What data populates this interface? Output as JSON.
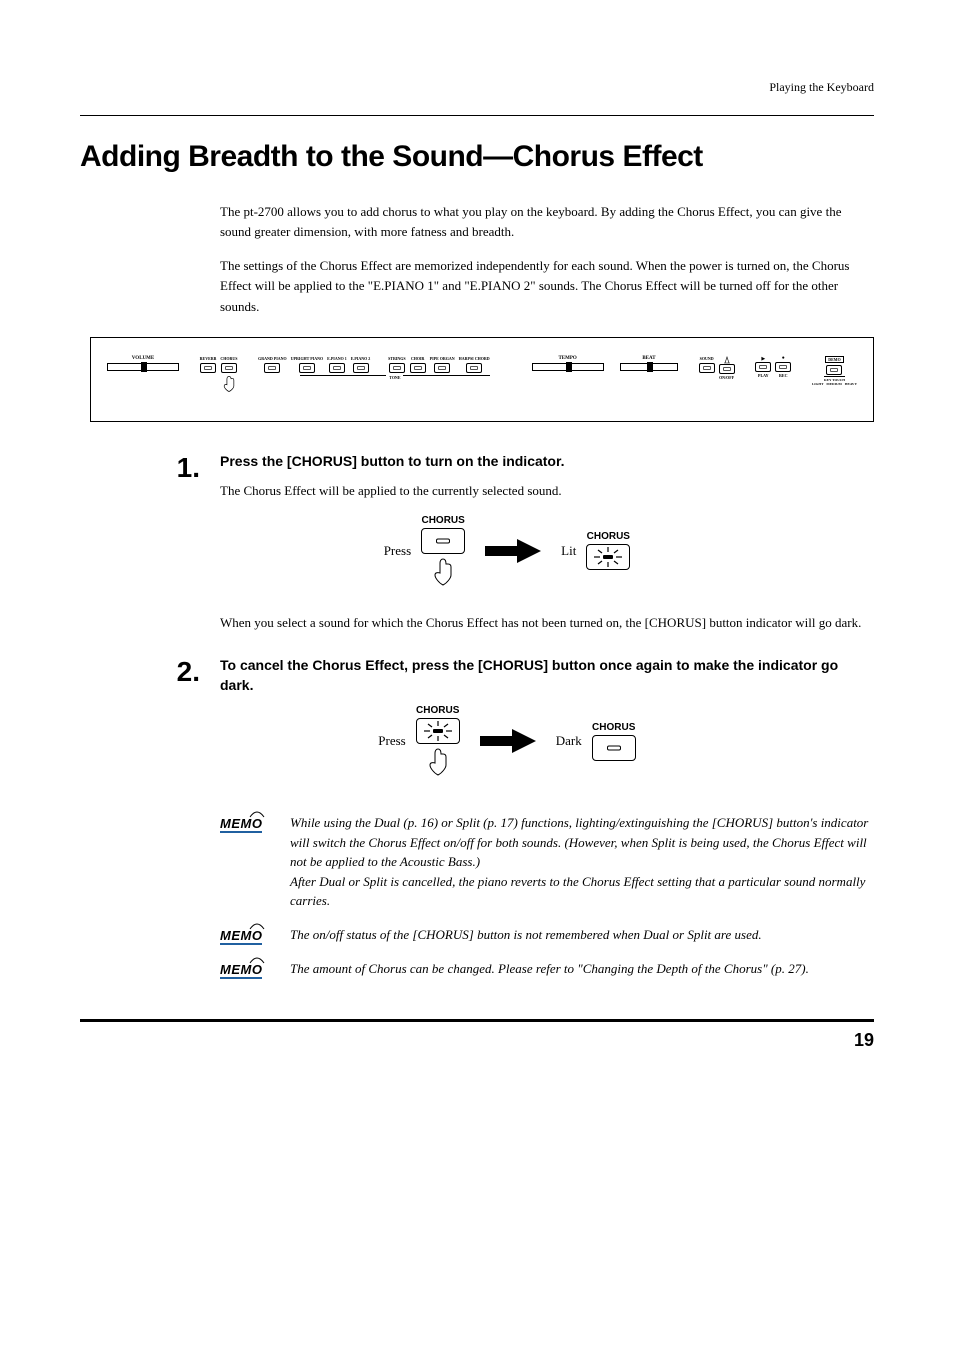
{
  "header": {
    "section": "Playing the Keyboard"
  },
  "title": "Adding Breadth to the Sound—Chorus Effect",
  "intro": {
    "p1": "The pt-2700 allows you to add chorus to what you play on the keyboard. By adding the Chorus Effect, you can give the sound greater dimension, with more fatness and breadth.",
    "p2": "The settings of the Chorus Effect are memorized independently for each sound. When the power is turned on, the Chorus Effect will be applied to the \"E.PIANO 1\" and \"E.PIANO 2\" sounds. The Chorus Effect will be turned off for the other sounds."
  },
  "panel": {
    "volume_label": "VOLUME",
    "tempo_label": "TEMPO",
    "beat_label": "BEAT",
    "tone_label": "TONE",
    "btn_reverb": "REVERB",
    "btn_chorus": "CHORUS",
    "btn_grand": "GRAND PIANO",
    "btn_upright": "UPRIGHT PIANO",
    "btn_ep1": "E.PIANO 1",
    "btn_ep2": "E.PIANO 2",
    "btn_strings": "STRINGS",
    "btn_choir": "CHOIR",
    "btn_pipe": "PIPE ORGAN",
    "btn_harpsi": "HARPSI CHORD",
    "btn_sound": "SOUND",
    "btn_metro": "",
    "btn_play": "PLAY",
    "btn_rec": "REC",
    "btn_demo": "DEMO",
    "keytouch": "KEY TOUCH",
    "onoff": "ON/OFF",
    "touch_light": "LIGHT",
    "touch_medium": "MEDIUM",
    "touch_heavy": "HEAVY"
  },
  "steps": [
    {
      "num": "1.",
      "head": "Press the [CHORUS] button to turn on the indicator.",
      "text1": "The Chorus Effect will be applied to the currently selected sound.",
      "text2": "When you select a sound for which the Chorus Effect has not been turned on, the [CHORUS] button indicator will go dark.",
      "dia_left": "Press",
      "dia_right": "Lit",
      "dia_btn": "CHORUS"
    },
    {
      "num": "2.",
      "head": "To cancel the Chorus Effect, press the [CHORUS] button once again to make the indicator go dark.",
      "dia_left": "Press",
      "dia_right": "Dark",
      "dia_btn": "CHORUS"
    }
  ],
  "memos": [
    {
      "label": "MEMO",
      "text": "While using the Dual (p. 16) or Split (p. 17) functions, lighting/extinguishing the [CHORUS] button's indicator will switch the Chorus Effect on/off for both sounds. (However, when Split is being used, the Chorus Effect will not be applied to the Acoustic Bass.)\nAfter Dual or Split is cancelled, the piano reverts to the Chorus Effect setting that a particular sound normally carries."
    },
    {
      "label": "MEMO",
      "text": "The on/off status of the [CHORUS] button is not remembered when Dual or Split are used."
    },
    {
      "label": "MEMO",
      "text": "The amount of Chorus can be changed. Please refer to \"Changing the Depth of the Chorus\" (p. 27)."
    }
  ],
  "page_number": "19"
}
